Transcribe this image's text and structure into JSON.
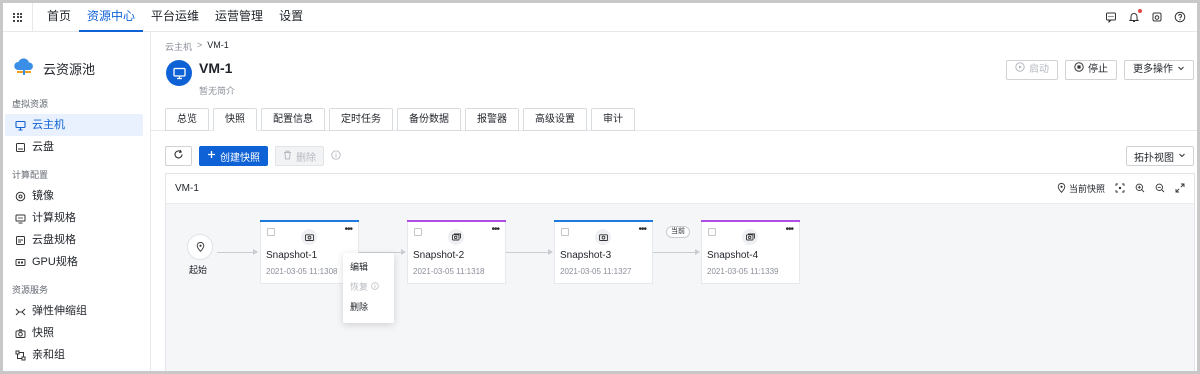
{
  "topnav": {
    "items": [
      {
        "label": "首页",
        "active": false
      },
      {
        "label": "资源中心",
        "active": true
      },
      {
        "label": "平台运维",
        "active": false
      },
      {
        "label": "运营管理",
        "active": false
      },
      {
        "label": "设置",
        "active": false
      }
    ],
    "right_icons": [
      "message-icon",
      "bell-icon",
      "package-icon",
      "help-icon"
    ],
    "accent_color": "#0f62d6"
  },
  "sidebar": {
    "title": "云资源池",
    "groups": [
      {
        "label": "虚拟资源",
        "items": [
          {
            "label": "云主机",
            "icon": "monitor-icon",
            "active": true
          },
          {
            "label": "云盘",
            "icon": "disk-icon",
            "active": false
          }
        ]
      },
      {
        "label": "计算配置",
        "items": [
          {
            "label": "镜像",
            "icon": "image-icon",
            "active": false
          },
          {
            "label": "计算规格",
            "icon": "compute-spec-icon",
            "active": false
          },
          {
            "label": "云盘规格",
            "icon": "disk-spec-icon",
            "active": false
          },
          {
            "label": "GPU规格",
            "icon": "gpu-icon",
            "active": false
          }
        ]
      },
      {
        "label": "资源服务",
        "items": [
          {
            "label": "弹性伸缩组",
            "icon": "scaling-icon",
            "active": false
          },
          {
            "label": "快照",
            "icon": "camera-icon",
            "active": false
          },
          {
            "label": "亲和组",
            "icon": "affinity-icon",
            "active": false
          }
        ]
      }
    ]
  },
  "breadcrumb": {
    "parent": "云主机",
    "separator": ">",
    "current": "VM-1"
  },
  "vm": {
    "name": "VM-1",
    "description": "暂无简介"
  },
  "header_actions": {
    "start": "启动",
    "stop": "停止",
    "more": "更多操作"
  },
  "tabs": [
    {
      "label": "总览",
      "active": false
    },
    {
      "label": "快照",
      "active": true
    },
    {
      "label": "配置信息",
      "active": false
    },
    {
      "label": "定时任务",
      "active": false
    },
    {
      "label": "备份数据",
      "active": false
    },
    {
      "label": "报警器",
      "active": false
    },
    {
      "label": "高级设置",
      "active": false
    },
    {
      "label": "审计",
      "active": false
    }
  ],
  "toolbar": {
    "create": "创建快照",
    "delete": "删除",
    "view": "拓扑视图"
  },
  "panel": {
    "title": "VM-1",
    "current_snapshot": "当前快照"
  },
  "topology": {
    "start_label": "起始",
    "current_badge": "当前",
    "snapshots": [
      {
        "name": "Snapshot-1",
        "time": "2021-03-05 11:1308",
        "color": "#1f7ae0"
      },
      {
        "name": "Snapshot-2",
        "time": "2021-03-05 11:1318",
        "color": "#b04de3"
      },
      {
        "name": "Snapshot-3",
        "time": "2021-03-05 11:1327",
        "color": "#1f7ae0"
      },
      {
        "name": "Snapshot-4",
        "time": "2021-03-05 11:1339",
        "color": "#b04de3"
      }
    ],
    "context_menu": {
      "edit": "编辑",
      "restore": "恢复",
      "delete": "删除"
    }
  }
}
